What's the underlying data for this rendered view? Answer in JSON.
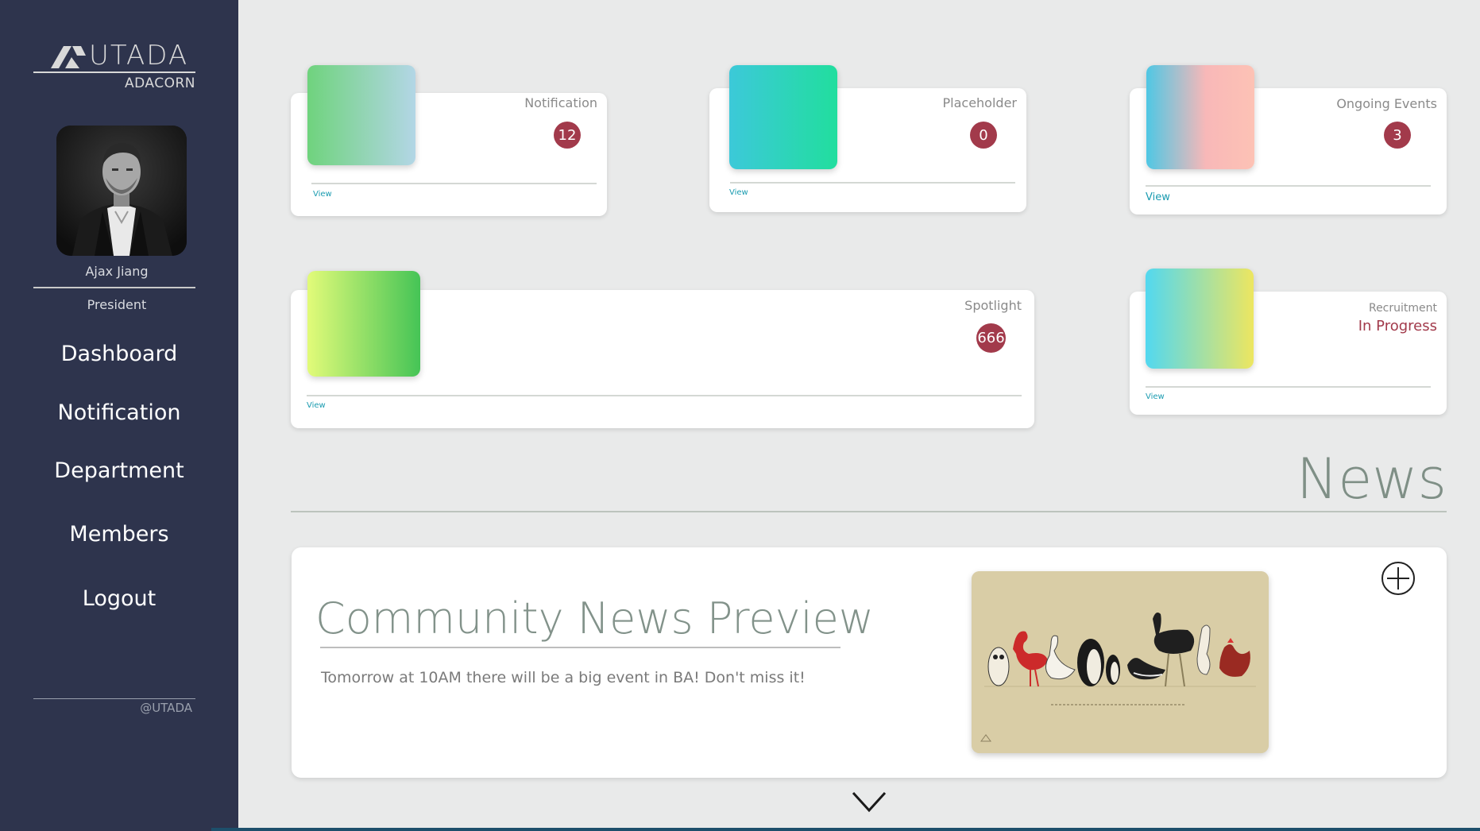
{
  "brand": {
    "name": "UTADA",
    "sub": "ADACORN",
    "footer": "@UTADA"
  },
  "user": {
    "name": "Ajax Jiang",
    "role": "President"
  },
  "nav": [
    {
      "label": "Dashboard"
    },
    {
      "label": "Notification"
    },
    {
      "label": "Department"
    },
    {
      "label": "Members"
    },
    {
      "label": "Logout"
    }
  ],
  "cards": {
    "notification": {
      "title": "Notification",
      "count": "12",
      "view": "View"
    },
    "placeholder": {
      "title": "Placeholder",
      "count": "0",
      "view": "View"
    },
    "ongoing": {
      "title": "Ongoing Events",
      "count": "3",
      "view": "View"
    },
    "spotlight": {
      "title": "Spotlight",
      "count": "666",
      "view": "View"
    },
    "recruitment": {
      "title": "Recruitment",
      "status": "In Progress",
      "view": "View"
    }
  },
  "news": {
    "heading": "News",
    "title": "Community News Preview",
    "text": "Tomorrow at 10AM there will be a big event in BA! Don't miss it!"
  },
  "colors": {
    "sidebar": "#2e344d",
    "badge": "#a23a4b",
    "link": "#1a9bb0",
    "status": "#a23a4b"
  },
  "icons": [
    "add-circle-icon",
    "chevron-down-icon",
    "logo-mark-icon"
  ]
}
